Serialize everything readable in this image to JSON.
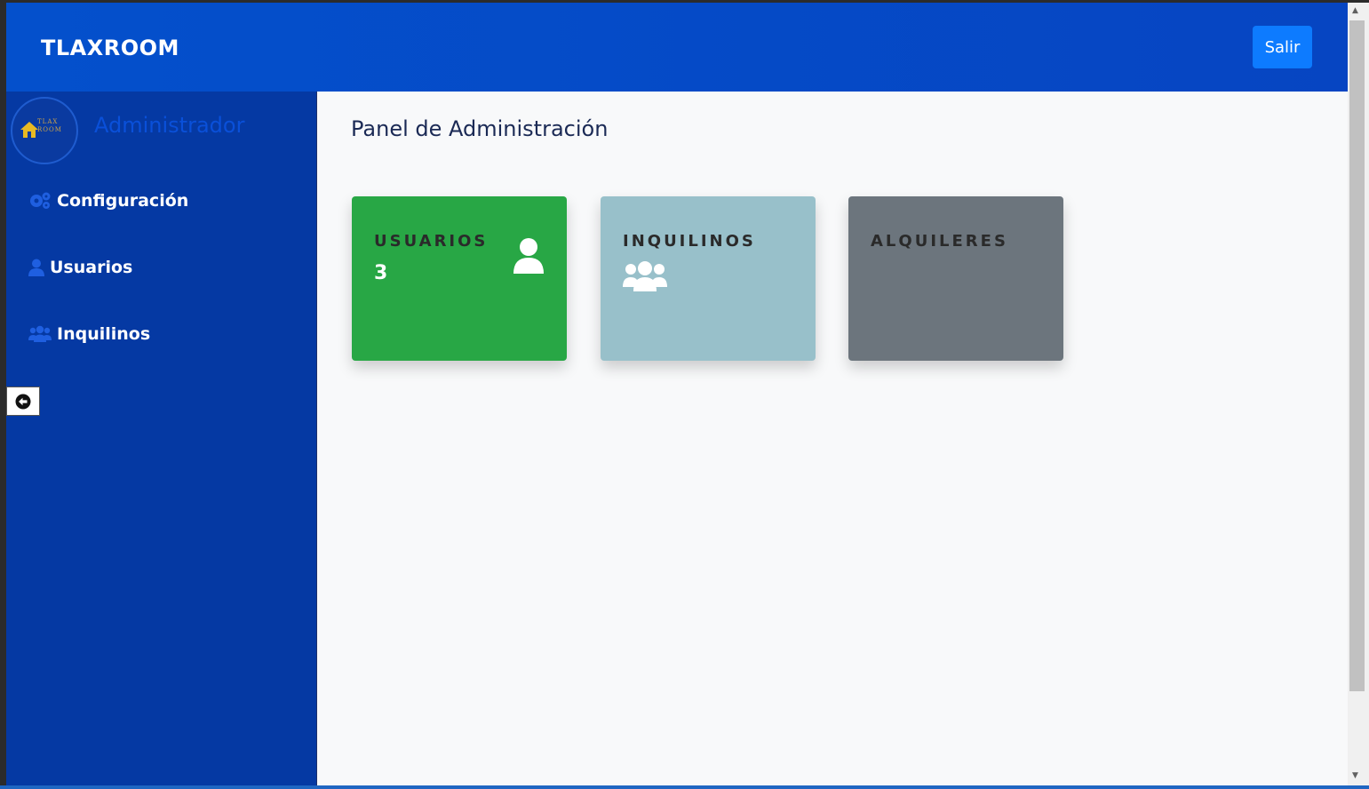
{
  "header": {
    "brand": "TLAXROOM",
    "logout_label": "Salir"
  },
  "sidebar": {
    "logo_text": "TLAX ROOM",
    "role": "Administrador",
    "items": [
      {
        "label": "Configuración",
        "icon": "gears-icon"
      },
      {
        "label": "Usuarios",
        "icon": "user-icon"
      },
      {
        "label": "Inquilinos",
        "icon": "users-icon"
      }
    ],
    "collapse_icon": "arrow-left-circle-icon"
  },
  "main": {
    "title": "Panel de Administración",
    "cards": [
      {
        "label": "USUARIOS",
        "count": "3",
        "icon": "user-icon",
        "color": "#28a745"
      },
      {
        "label": "INQUILINOS",
        "icon": "users-icon",
        "color": "#98c0ca"
      },
      {
        "label": "ALQUILERES",
        "color": "#6c757d"
      }
    ]
  },
  "colors": {
    "header": "#0450cc",
    "sidebar": "#0539a3",
    "logout_button": "#0d7bff",
    "role_text": "#0a50d9"
  }
}
